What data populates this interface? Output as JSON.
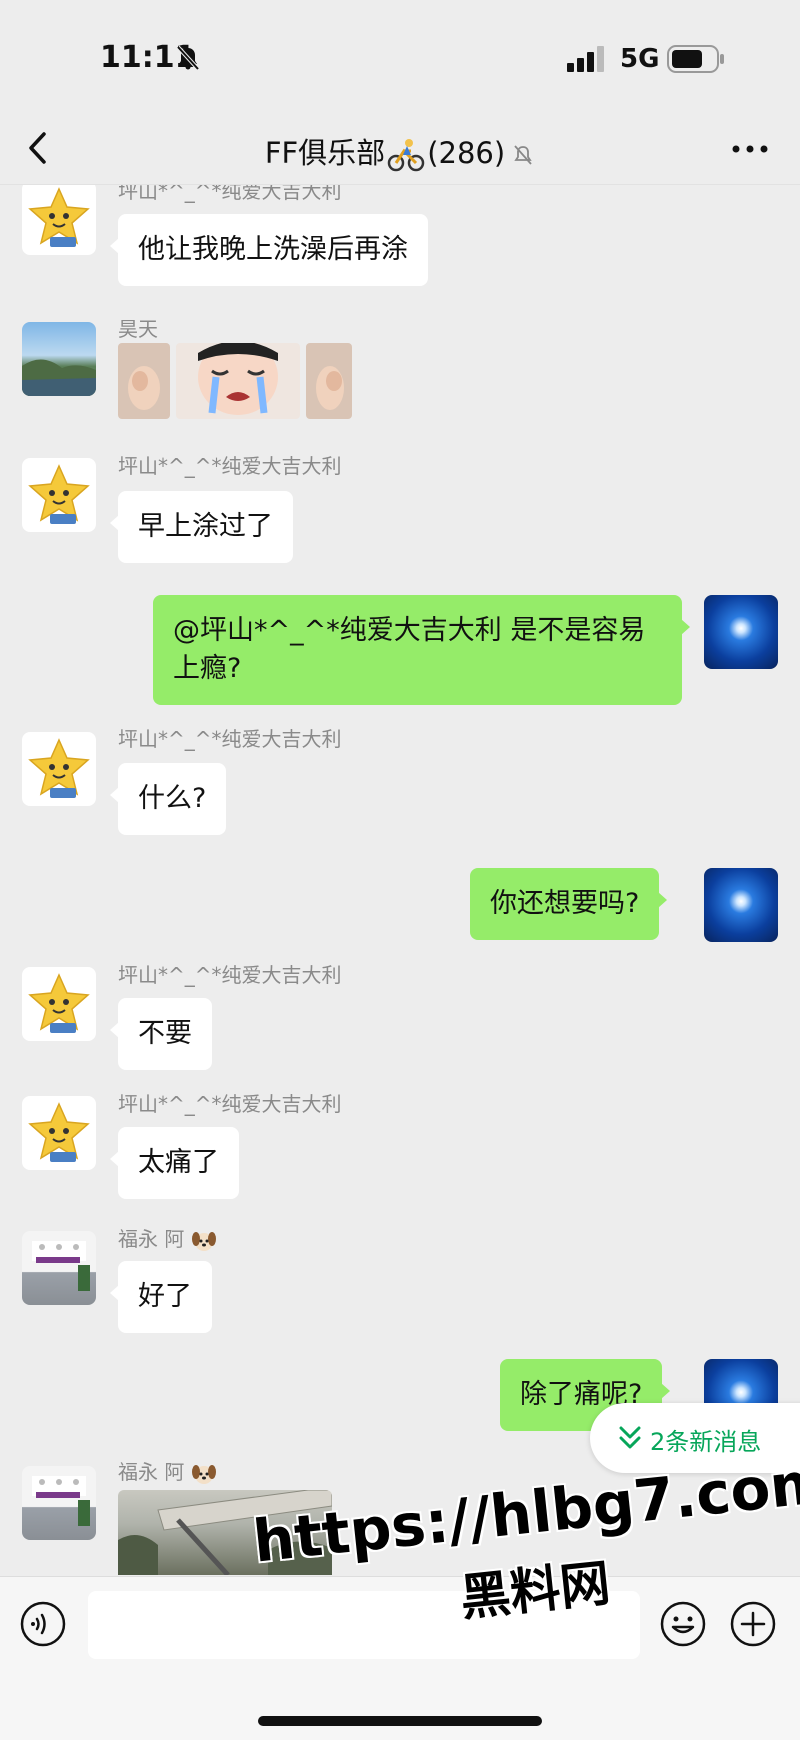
{
  "status": {
    "time": "11:11",
    "network": "5G"
  },
  "nav": {
    "title": "FF俱乐部",
    "count": "(286)"
  },
  "messages": [
    {
      "sender": "坪山*^_^*纯爱大吉大利",
      "text": "他让我晚上洗澡后再涂"
    },
    {
      "sender": "昊天"
    },
    {
      "sender": "坪山*^_^*纯爱大吉大利",
      "text": "早上涂过了"
    },
    {
      "text": "@坪山*^_^*纯爱大吉大利 是不是容易上瘾?"
    },
    {
      "sender": "坪山*^_^*纯爱大吉大利",
      "text": "什么?"
    },
    {
      "text": "你还想要吗?"
    },
    {
      "sender": "坪山*^_^*纯爱大吉大利",
      "text": "不要"
    },
    {
      "sender": "坪山*^_^*纯爱大吉大利",
      "text": "太痛了"
    },
    {
      "sender": "福永 阿",
      "text": "好了"
    },
    {
      "text": "除了痛呢?"
    },
    {
      "sender": "福永 阿"
    }
  ],
  "new_messages_label": "2条新消息",
  "watermark": {
    "line1": "https://hlbg7.com",
    "line2": "黑料网"
  },
  "icons": {
    "back": "back-arrow-icon",
    "more": "more-icon",
    "voice": "voice-icon",
    "emoji": "emoji-icon",
    "plus": "plus-icon"
  }
}
